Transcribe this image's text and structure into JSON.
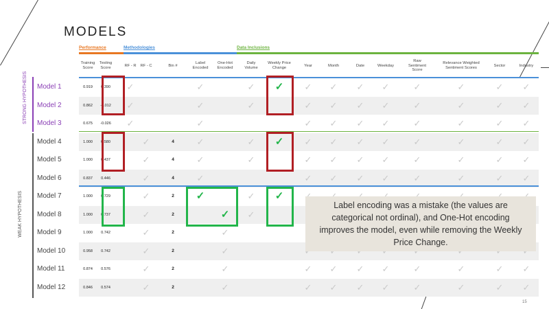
{
  "title": "MODELS",
  "groups": [
    {
      "label": "Performance",
      "color": "#e87722"
    },
    {
      "label": "Methodologies",
      "color": "#4a90d9"
    },
    {
      "label": "Data Inclusions",
      "color": "#6cb33f"
    }
  ],
  "columns": [
    "Training Score",
    "Testing Score",
    "RF - R",
    "RF - C",
    "Bin #",
    "Label Encoded",
    "One-Hot Encoded",
    "Daily Volume",
    "Weekly Price Change",
    "Year",
    "Month",
    "Date",
    "Weekday",
    "Raw Sentiment Score",
    "Relevance Weighted Sentiment Scores",
    "Sector",
    "Industry"
  ],
  "hypotheses": [
    {
      "label": "STRONG HYPOTHESIS",
      "color": "#8a3fb5"
    },
    {
      "label": "WEAK HYPOTHESIS",
      "color": "#555555"
    }
  ],
  "models": [
    {
      "name": "Model 1",
      "train": "0.919",
      "test": "0.390",
      "bin": "",
      "checks": {
        "rfr": true,
        "label": true,
        "volume": true,
        "weekly": "green",
        "year": true,
        "month": true,
        "date": true,
        "weekday": true,
        "raw": true,
        "rel": true,
        "sector": true,
        "industry": true
      }
    },
    {
      "name": "Model 2",
      "train": "0.862",
      "test": "-0.012",
      "bin": "",
      "checks": {
        "rfr": true,
        "label": true,
        "volume": true,
        "year": true,
        "month": true,
        "date": true,
        "weekday": true,
        "raw": true,
        "rel": true,
        "sector": true,
        "industry": true
      }
    },
    {
      "name": "Model 3",
      "train": "0.675",
      "test": "-0.026",
      "bin": "",
      "checks": {
        "rfr": true,
        "label": true,
        "year": true,
        "month": true,
        "date": true,
        "weekday": true,
        "raw": true,
        "rel": true,
        "sector": true,
        "industry": true
      }
    },
    {
      "name": "Model 4",
      "train": "1.000",
      "test": "0.580",
      "bin": "4",
      "checks": {
        "rfc": true,
        "label": true,
        "volume": true,
        "weekly": "green",
        "year": true,
        "month": true,
        "date": true,
        "weekday": true,
        "raw": true,
        "rel": true,
        "sector": true,
        "industry": true
      }
    },
    {
      "name": "Model 5",
      "train": "1.000",
      "test": "0.437",
      "bin": "4",
      "checks": {
        "rfc": true,
        "label": true,
        "volume": true,
        "year": true,
        "month": true,
        "date": true,
        "weekday": true,
        "raw": true,
        "rel": true,
        "sector": true,
        "industry": true
      }
    },
    {
      "name": "Model 6",
      "train": "0.837",
      "test": "0.446",
      "bin": "4",
      "checks": {
        "rfc": true,
        "label": true,
        "year": true,
        "month": true,
        "date": true,
        "weekday": true,
        "raw": true,
        "rel": true,
        "sector": true,
        "industry": true
      }
    },
    {
      "name": "Model 7",
      "train": "1.000",
      "test": "0.729",
      "bin": "2",
      "checks": {
        "rfc": true,
        "label": "green",
        "volume": true,
        "weekly": "green",
        "year": true,
        "month": true,
        "date": true,
        "weekday": true,
        "raw": true,
        "rel": true,
        "sector": true,
        "industry": true
      }
    },
    {
      "name": "Model 8",
      "train": "1.000",
      "test": "0.737",
      "bin": "2",
      "checks": {
        "rfc": true,
        "onehot": "green",
        "volume": true,
        "year": true,
        "month": true,
        "date": true,
        "weekday": true,
        "raw": true,
        "rel": true,
        "sector": true,
        "industry": true
      }
    },
    {
      "name": "Model 9",
      "train": "1.000",
      "test": "0.742",
      "bin": "2",
      "checks": {
        "rfc": true,
        "onehot": true,
        "year": true,
        "month": true,
        "date": true,
        "weekday": true,
        "raw": true,
        "rel": true,
        "sector": true,
        "industry": true
      }
    },
    {
      "name": "Model 10",
      "train": "0.958",
      "test": "0.742",
      "bin": "2",
      "checks": {
        "rfc": true,
        "onehot": true,
        "year": true,
        "month": true,
        "date": true,
        "weekday": true,
        "raw": true,
        "rel": true,
        "sector": true,
        "industry": true
      }
    },
    {
      "name": "Model 11",
      "train": "0.874",
      "test": "0.576",
      "bin": "2",
      "checks": {
        "rfc": true,
        "onehot": true,
        "year": true,
        "month": true,
        "date": true,
        "weekday": true,
        "raw": true,
        "rel": true,
        "sector": true,
        "industry": true
      }
    },
    {
      "name": "Model 12",
      "train": "0.846",
      "test": "0.574",
      "bin": "2",
      "checks": {
        "rfc": true,
        "onehot": true,
        "year": true,
        "month": true,
        "date": true,
        "weekday": true,
        "raw": true,
        "rel": true,
        "sector": true,
        "industry": true
      }
    }
  ],
  "callout": "Label encoding was a mistake (the values are categorical not ordinal), and One-Hot encoding improves the model, even while removing the Weekly Price Change.",
  "page_number": "15"
}
